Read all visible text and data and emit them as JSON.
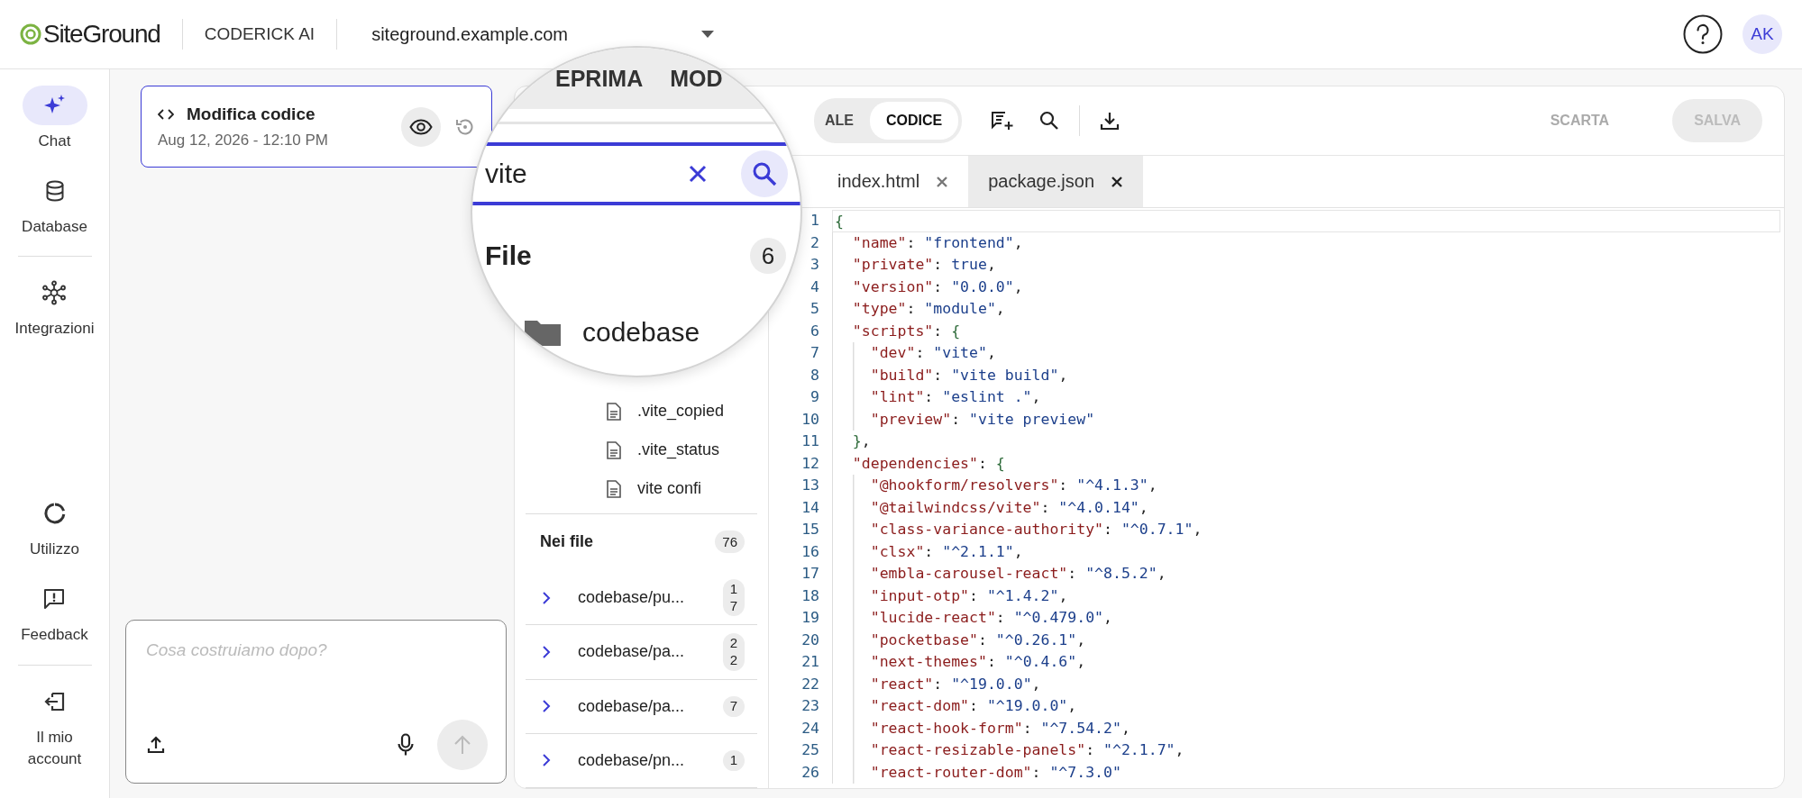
{
  "header": {
    "logo": "SiteGround",
    "product": "CODERICK AI",
    "site": "siteground.example.com",
    "avatar": "AK"
  },
  "nav": {
    "top": [
      {
        "label": "Chat",
        "selected": true
      },
      {
        "label": "Database",
        "selected": false
      },
      {
        "label": "Integrazioni",
        "selected": false
      }
    ],
    "bottom": [
      {
        "label": "Utilizzo"
      },
      {
        "label": "Feedback"
      },
      {
        "label": "Il mio account"
      }
    ]
  },
  "chat": {
    "card": {
      "title": "Modifica codice",
      "date": "Aug 12, 2026 - 12:10 PM"
    },
    "input": {
      "placeholder": "Cosa costruiamo dopo?"
    }
  },
  "editor": {
    "modes": [
      {
        "label": "ALE",
        "selected": false
      },
      {
        "label": "CODICE",
        "selected": true
      }
    ],
    "actions": [
      {
        "label": "SCARTA",
        "kind": "text",
        "disabled": true
      },
      {
        "label": "SALVA",
        "kind": "filled",
        "disabled": true
      }
    ],
    "tree": [
      ".vite_copied",
      ".vite_status",
      "vite confi"
    ],
    "in_files": {
      "title": "Nei file",
      "count": "76",
      "results": [
        {
          "path": "codebase/pu...",
          "count": "17"
        },
        {
          "path": "codebase/pa...",
          "count": "22"
        },
        {
          "path": "codebase/pa...",
          "count": "7"
        },
        {
          "path": "codebase/pn...",
          "count": "1"
        }
      ]
    },
    "tabs": [
      {
        "label": "index.html",
        "selected": false
      },
      {
        "label": "package.json",
        "selected": true
      }
    ],
    "code": [
      {
        "number": "1",
        "current": true,
        "tokens": [
          {
            "kind": "brace",
            "text": "{"
          }
        ]
      },
      {
        "number": "2",
        "current": false,
        "tokens": [
          {
            "kind": "key",
            "text": "  \"name\""
          },
          {
            "kind": "punct",
            "text": ": "
          },
          {
            "kind": "string",
            "text": "\"frontend\""
          },
          {
            "kind": "punct",
            "text": ","
          }
        ]
      },
      {
        "number": "3",
        "current": false,
        "tokens": [
          {
            "kind": "key",
            "text": "  \"private\""
          },
          {
            "kind": "punct",
            "text": ": "
          },
          {
            "kind": "bool",
            "text": "true"
          },
          {
            "kind": "punct",
            "text": ","
          }
        ]
      },
      {
        "number": "4",
        "current": false,
        "tokens": [
          {
            "kind": "key",
            "text": "  \"version\""
          },
          {
            "kind": "punct",
            "text": ": "
          },
          {
            "kind": "string",
            "text": "\"0.0.0\""
          },
          {
            "kind": "punct",
            "text": ","
          }
        ]
      },
      {
        "number": "5",
        "current": false,
        "tokens": [
          {
            "kind": "key",
            "text": "  \"type\""
          },
          {
            "kind": "punct",
            "text": ": "
          },
          {
            "kind": "string",
            "text": "\"module\""
          },
          {
            "kind": "punct",
            "text": ","
          }
        ]
      },
      {
        "number": "6",
        "current": false,
        "tokens": [
          {
            "kind": "key",
            "text": "  \"scripts\""
          },
          {
            "kind": "punct",
            "text": ": "
          },
          {
            "kind": "brace",
            "text": "{"
          }
        ]
      },
      {
        "number": "7",
        "current": false,
        "tokens": [
          {
            "kind": "key",
            "text": "    \"dev\""
          },
          {
            "kind": "punct",
            "text": ": "
          },
          {
            "kind": "string",
            "text": "\"vite\""
          },
          {
            "kind": "punct",
            "text": ","
          }
        ]
      },
      {
        "number": "8",
        "current": false,
        "tokens": [
          {
            "kind": "key",
            "text": "    \"build\""
          },
          {
            "kind": "punct",
            "text": ": "
          },
          {
            "kind": "string",
            "text": "\"vite build\""
          },
          {
            "kind": "punct",
            "text": ","
          }
        ]
      },
      {
        "number": "9",
        "current": false,
        "tokens": [
          {
            "kind": "key",
            "text": "    \"lint\""
          },
          {
            "kind": "punct",
            "text": ": "
          },
          {
            "kind": "string",
            "text": "\"eslint .\""
          },
          {
            "kind": "punct",
            "text": ","
          }
        ]
      },
      {
        "number": "10",
        "current": false,
        "tokens": [
          {
            "kind": "key",
            "text": "    \"preview\""
          },
          {
            "kind": "punct",
            "text": ": "
          },
          {
            "kind": "string",
            "text": "\"vite preview\""
          }
        ]
      },
      {
        "number": "11",
        "current": false,
        "tokens": [
          {
            "kind": "brace",
            "text": "  }"
          },
          {
            "kind": "punct",
            "text": ","
          }
        ]
      },
      {
        "number": "12",
        "current": false,
        "tokens": [
          {
            "kind": "key",
            "text": "  \"dependencies\""
          },
          {
            "kind": "punct",
            "text": ": "
          },
          {
            "kind": "brace",
            "text": "{"
          }
        ]
      },
      {
        "number": "13",
        "current": false,
        "tokens": [
          {
            "kind": "key",
            "text": "    \"@hookform/resolvers\""
          },
          {
            "kind": "punct",
            "text": ": "
          },
          {
            "kind": "string",
            "text": "\"^4.1.3\""
          },
          {
            "kind": "punct",
            "text": ","
          }
        ]
      },
      {
        "number": "14",
        "current": false,
        "tokens": [
          {
            "kind": "key",
            "text": "    \"@tailwindcss/vite\""
          },
          {
            "kind": "punct",
            "text": ": "
          },
          {
            "kind": "string",
            "text": "\"^4.0.14\""
          },
          {
            "kind": "punct",
            "text": ","
          }
        ]
      },
      {
        "number": "15",
        "current": false,
        "tokens": [
          {
            "kind": "key",
            "text": "    \"class-variance-authority\""
          },
          {
            "kind": "punct",
            "text": ": "
          },
          {
            "kind": "string",
            "text": "\"^0.7.1\""
          },
          {
            "kind": "punct",
            "text": ","
          }
        ]
      },
      {
        "number": "16",
        "current": false,
        "tokens": [
          {
            "kind": "key",
            "text": "    \"clsx\""
          },
          {
            "kind": "punct",
            "text": ": "
          },
          {
            "kind": "string",
            "text": "\"^2.1.1\""
          },
          {
            "kind": "punct",
            "text": ","
          }
        ]
      },
      {
        "number": "17",
        "current": false,
        "tokens": [
          {
            "kind": "key",
            "text": "    \"embla-carousel-react\""
          },
          {
            "kind": "punct",
            "text": ": "
          },
          {
            "kind": "string",
            "text": "\"^8.5.2\""
          },
          {
            "kind": "punct",
            "text": ","
          }
        ]
      },
      {
        "number": "18",
        "current": false,
        "tokens": [
          {
            "kind": "key",
            "text": "    \"input-otp\""
          },
          {
            "kind": "punct",
            "text": ": "
          },
          {
            "kind": "string",
            "text": "\"^1.4.2\""
          },
          {
            "kind": "punct",
            "text": ","
          }
        ]
      },
      {
        "number": "19",
        "current": false,
        "tokens": [
          {
            "kind": "key",
            "text": "    \"lucide-react\""
          },
          {
            "kind": "punct",
            "text": ": "
          },
          {
            "kind": "string",
            "text": "\"^0.479.0\""
          },
          {
            "kind": "punct",
            "text": ","
          }
        ]
      },
      {
        "number": "20",
        "current": false,
        "tokens": [
          {
            "kind": "key",
            "text": "    \"pocketbase\""
          },
          {
            "kind": "punct",
            "text": ": "
          },
          {
            "kind": "string",
            "text": "\"^0.26.1\""
          },
          {
            "kind": "punct",
            "text": ","
          }
        ]
      },
      {
        "number": "21",
        "current": false,
        "tokens": [
          {
            "kind": "key",
            "text": "    \"next-themes\""
          },
          {
            "kind": "punct",
            "text": ": "
          },
          {
            "kind": "string",
            "text": "\"^0.4.6\""
          },
          {
            "kind": "punct",
            "text": ","
          }
        ]
      },
      {
        "number": "22",
        "current": false,
        "tokens": [
          {
            "kind": "key",
            "text": "    \"react\""
          },
          {
            "kind": "punct",
            "text": ": "
          },
          {
            "kind": "string",
            "text": "\"^19.0.0\""
          },
          {
            "kind": "punct",
            "text": ","
          }
        ]
      },
      {
        "number": "23",
        "current": false,
        "tokens": [
          {
            "kind": "key",
            "text": "    \"react-dom\""
          },
          {
            "kind": "punct",
            "text": ": "
          },
          {
            "kind": "string",
            "text": "\"^19.0.0\""
          },
          {
            "kind": "punct",
            "text": ","
          }
        ]
      },
      {
        "number": "24",
        "current": false,
        "tokens": [
          {
            "kind": "key",
            "text": "    \"react-hook-form\""
          },
          {
            "kind": "punct",
            "text": ": "
          },
          {
            "kind": "string",
            "text": "\"^7.54.2\""
          },
          {
            "kind": "punct",
            "text": ","
          }
        ]
      },
      {
        "number": "25",
        "current": false,
        "tokens": [
          {
            "kind": "key",
            "text": "    \"react-resizable-panels\""
          },
          {
            "kind": "punct",
            "text": ": "
          },
          {
            "kind": "string",
            "text": "\"^2.1.7\""
          },
          {
            "kind": "punct",
            "text": ","
          }
        ]
      },
      {
        "number": "26",
        "current": false,
        "tokens": [
          {
            "kind": "key",
            "text": "    \"react-router-dom\""
          },
          {
            "kind": "punct",
            "text": ": "
          },
          {
            "kind": "string",
            "text": "\"^7.3.0\""
          }
        ]
      }
    ]
  },
  "magnifier": {
    "tabs": [
      "EPRIMA",
      "MOD"
    ],
    "search": {
      "value": "vite"
    },
    "files_title": "File",
    "files_count": "6",
    "folder": "codebase"
  }
}
